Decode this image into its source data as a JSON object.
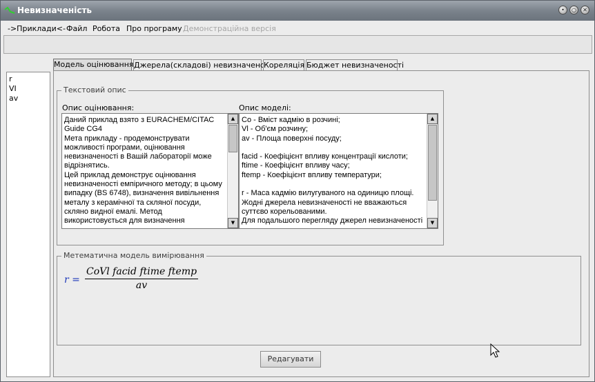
{
  "window": {
    "title": "Невизначеність",
    "controls": {
      "minimize_glyph": "•",
      "maximize_glyph": "○",
      "close_glyph": "✕"
    }
  },
  "menu": [
    {
      "label": "->Приклади<-",
      "enabled": true
    },
    {
      "label": "Файл",
      "enabled": true
    },
    {
      "label": "Робота",
      "enabled": true
    },
    {
      "label": "Про програму",
      "enabled": true
    },
    {
      "label": "Демонстраційна версія",
      "enabled": false
    }
  ],
  "variables": [
    "r",
    "VI",
    "av"
  ],
  "tabs": [
    {
      "label": "Модель оцінювання",
      "active": true
    },
    {
      "label": "Джерела(складові) невизначеності",
      "active": false
    },
    {
      "label": "Кореляція",
      "active": false
    },
    {
      "label": "Бюджет невизначеності",
      "active": false
    }
  ],
  "text_description": {
    "group_title": "Текстовий опис",
    "evaluation": {
      "label": "Опис оцінювання:",
      "text": "Даний приклад взято з EURACHEM/CITAC Guide CG4\nМета прикладу - продемонструвати можливості програми, оцінювання невизначеності в Вашій лабораторії може відрізнятись.\nЦей приклад демонструє оцінювання невизначеності емпіричного методу; в цьому випадку (BS 6748), визначення вивільнення металу з керамічної та скляної посуди, скляно видної емалі. Метод використовується для визначення"
    },
    "model": {
      "label": "Опис моделі:",
      "text": "Co - Вміст кадмію в розчині;\nVl - Об'єм розчину;\nav - Площа поверхні посуду;\n\nfacid - Коефіцієнт впливу концентрації кислоти;\nftime - Коефіцієнт впливу часу;\nftemp - Коефіцієнт впливу температури;\n\nr - Маса кадмію вилугуваного на одиницю площі.\nЖодні джерела невизначеності не вважаються суттєво корельованими.\nДля подальшого перегляду джерел невизначеності"
    }
  },
  "math_model": {
    "group_title": "Метематична модель вимірювання",
    "lhs": "r =",
    "numerator": "CoVl facid ftime ftemp",
    "denominator": "av"
  },
  "buttons": {
    "edit": "Редагувати"
  },
  "colors": {
    "titlebar": "#7b838c",
    "formula_lhs": "#1a35b8",
    "disabled_menu": "#a6a6a6"
  }
}
